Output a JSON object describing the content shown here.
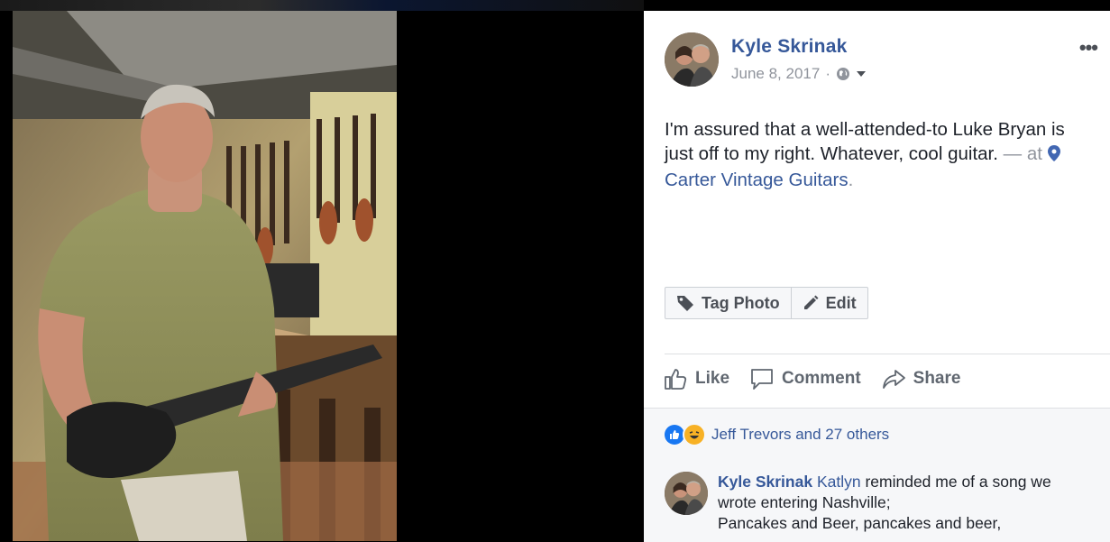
{
  "post": {
    "author": "Kyle Skrinak",
    "date": "June 8, 2017",
    "separator": "·",
    "privacy_icon": "globe-icon",
    "text_main": "I'm assured that a well-attended-to Luke Bryan is just off to my right. Whatever, cool guitar.",
    "at_label": "— at",
    "location": "Carter Vintage Guitars",
    "location_suffix": ".",
    "more_label": "•••"
  },
  "photo_actions": {
    "tag_label": "Tag Photo",
    "edit_label": "Edit"
  },
  "actions": {
    "like": "Like",
    "comment": "Comment",
    "share": "Share"
  },
  "reactions": {
    "summary": "Jeff Trevors and 27 others"
  },
  "comment": {
    "author": "Kyle Skrinak",
    "tag": "Katlyn",
    "text_line1": "reminded me of a song we wrote entering Nashville;",
    "text_line2": "Pancakes and Beer, pancakes and beer,"
  },
  "colors": {
    "link": "#365899",
    "muted": "#90949c",
    "like_blue": "#1877f2",
    "haha_yellow": "#f7b125"
  }
}
